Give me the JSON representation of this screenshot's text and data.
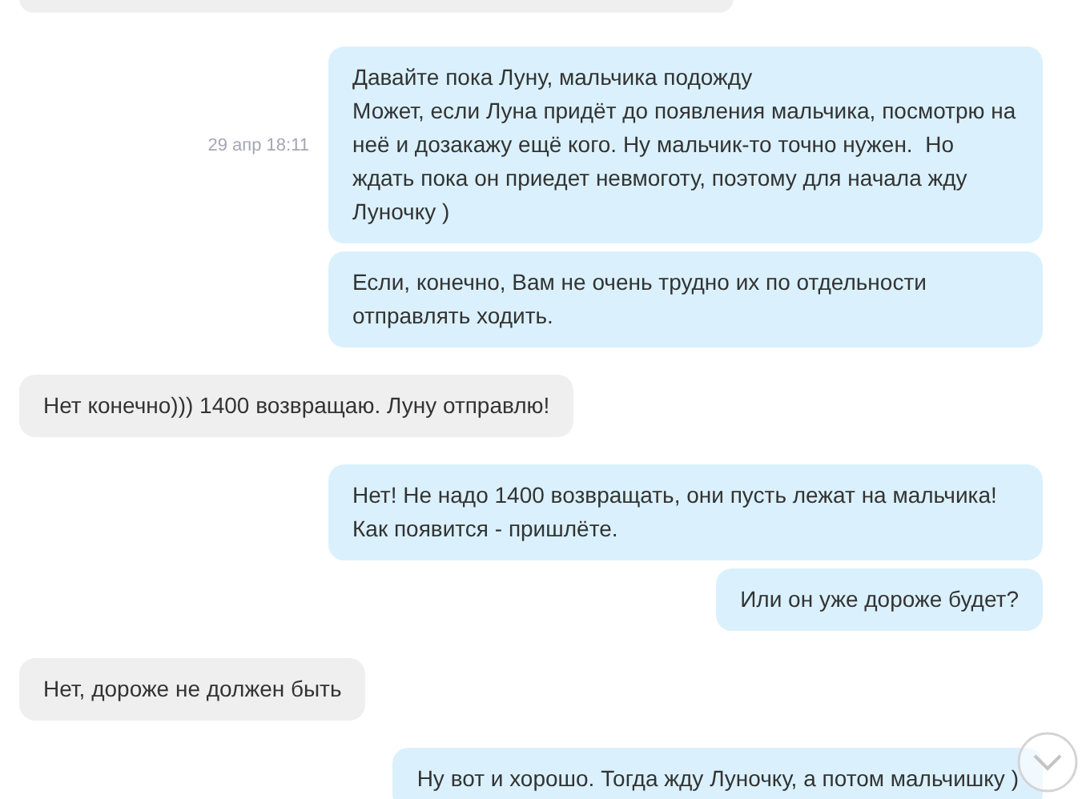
{
  "groups": [
    {
      "kind": "outgoing",
      "time": "29 апр 18:11",
      "messages": [
        "Давайте пока Луну, мальчика подожду\nМожет, если Луна придёт до появления мальчика, посмотрю на\nнеё и дозакажу ещё кого. Ну мальчик-то точно нужен.  Но\nждать пока он приедет невмоготу, поэтому для начала жду\nЛуночку )",
        "Если, конечно, Вам не очень трудно их по отдельности\nотправлять ходить."
      ]
    },
    {
      "kind": "incoming",
      "messages": [
        "Нет конечно))) 1400 возвращаю. Луну отправлю!"
      ]
    },
    {
      "kind": "outgoing",
      "messages": [
        "Нет! Не надо 1400 возвращать, они пусть лежат на мальчика!\nКак появится - пришлёте.",
        "Или он уже дороже будет?"
      ]
    },
    {
      "kind": "incoming",
      "messages": [
        "Нет, дороже не должен быть"
      ]
    },
    {
      "kind": "outgoing",
      "messages": [
        "Ну вот и хорошо. Тогда жду Луночку, а потом мальчишку )"
      ]
    }
  ]
}
